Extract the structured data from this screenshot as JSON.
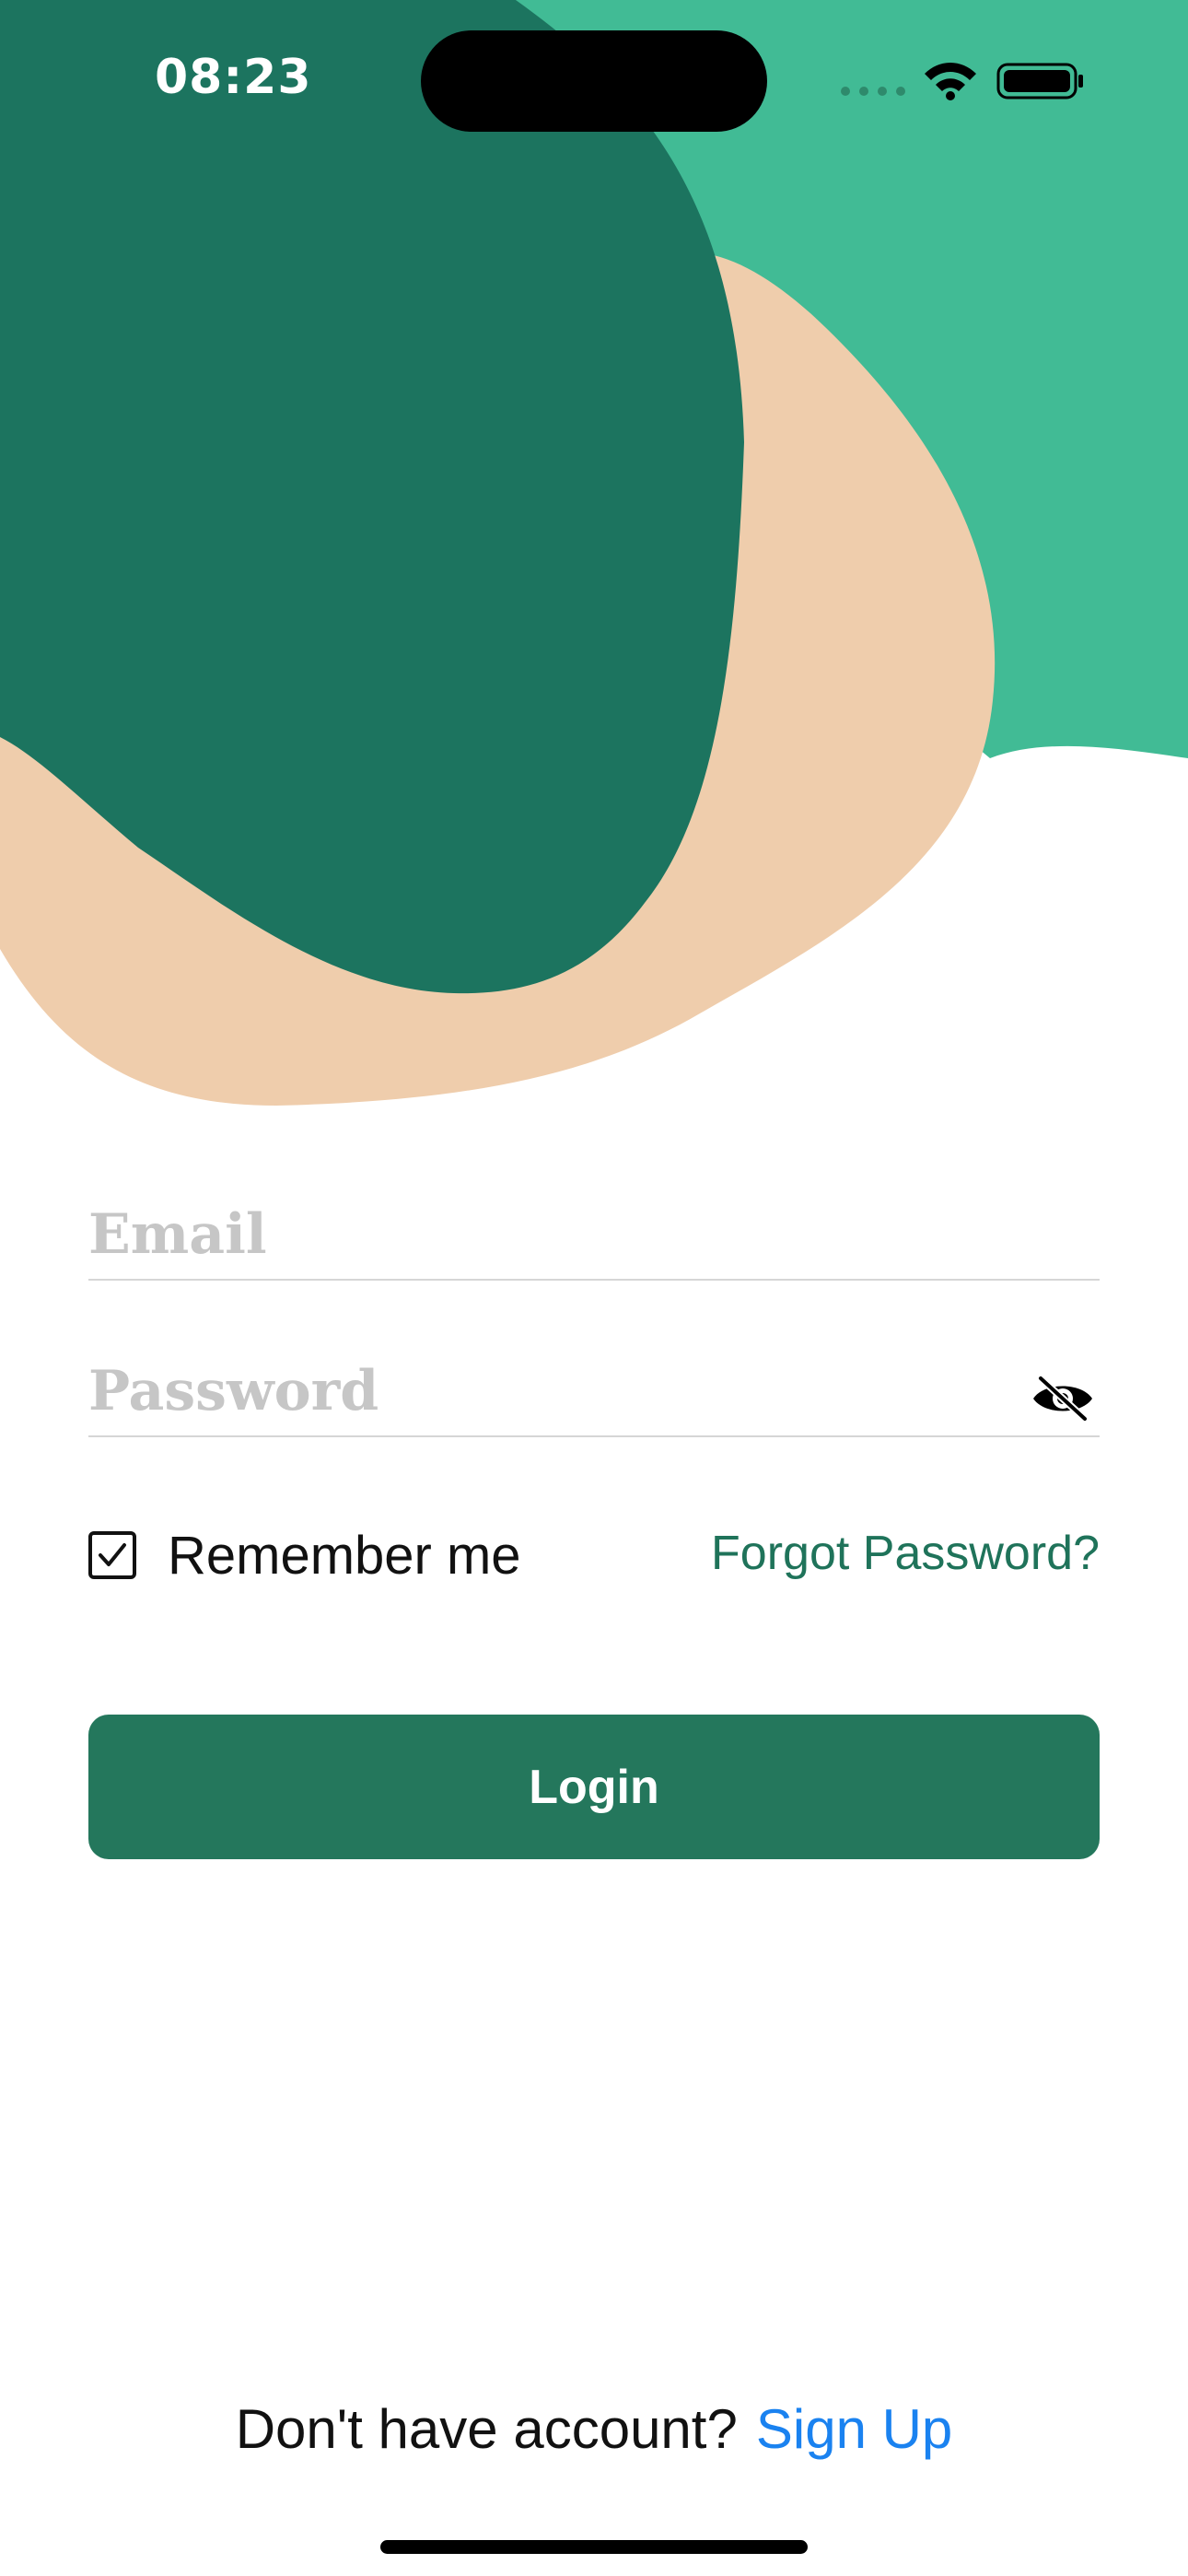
{
  "status_bar": {
    "time": "08:23"
  },
  "background": {
    "colors": {
      "light_green": "#41bb95",
      "dark_green": "#1c745f",
      "peach": "#efcdac"
    }
  },
  "login_form": {
    "email": {
      "placeholder": "Email",
      "value": ""
    },
    "password": {
      "placeholder": "Password",
      "value": "",
      "toggle_icon": "eye-slash-icon"
    },
    "remember_me": {
      "label": "Remember me",
      "checked": true
    },
    "forgot_password_label": "Forgot Password?",
    "login_button_label": "Login"
  },
  "signup": {
    "prompt": "Don't have account?",
    "link_label": "Sign Up"
  },
  "colors": {
    "accent_green": "#24775c",
    "link_blue": "#1a82f0",
    "forgot_green": "#1f735a"
  }
}
